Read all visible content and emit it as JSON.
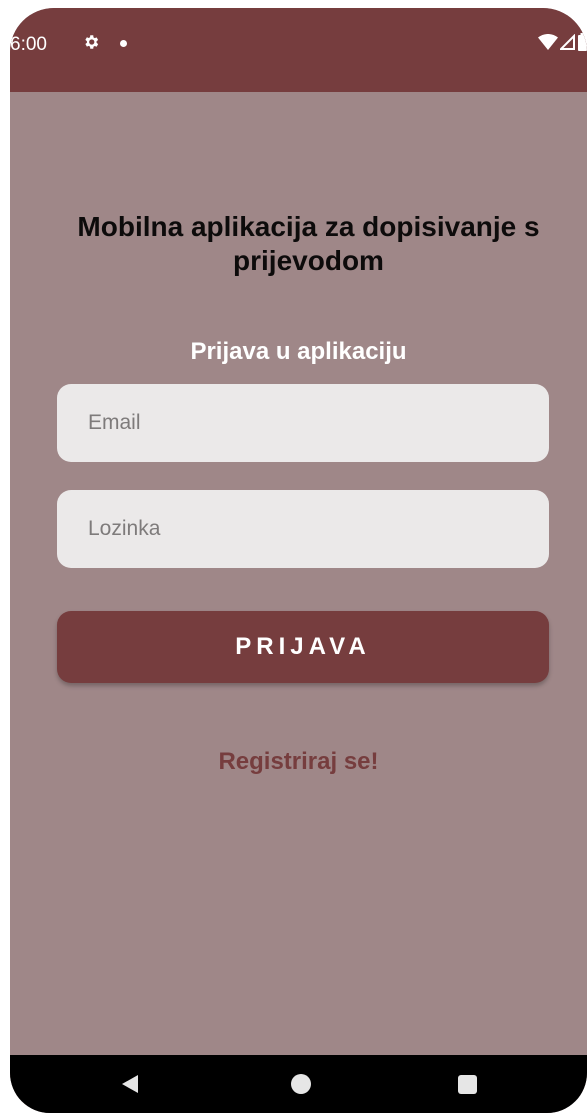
{
  "status_bar": {
    "time": "6:00",
    "icons": [
      "gear-icon",
      "notification-dot-icon",
      "wifi-icon",
      "signal-icon",
      "battery-icon"
    ],
    "background_color": "#763d3e"
  },
  "main": {
    "title": "Mobilna aplikacija za dopisivanje s prijevodom",
    "form_heading": "Prijava u aplikaciju",
    "email": {
      "placeholder": "Email",
      "value": ""
    },
    "password": {
      "placeholder": "Lozinka",
      "value": ""
    },
    "login_button_label": "PRIJAVA",
    "register_link": "Registriraj se!",
    "background_color": "#9f8788",
    "accent_color": "#763d3e"
  },
  "navigation_bar": {
    "icons": [
      "back-icon",
      "home-icon",
      "recents-icon"
    ]
  }
}
